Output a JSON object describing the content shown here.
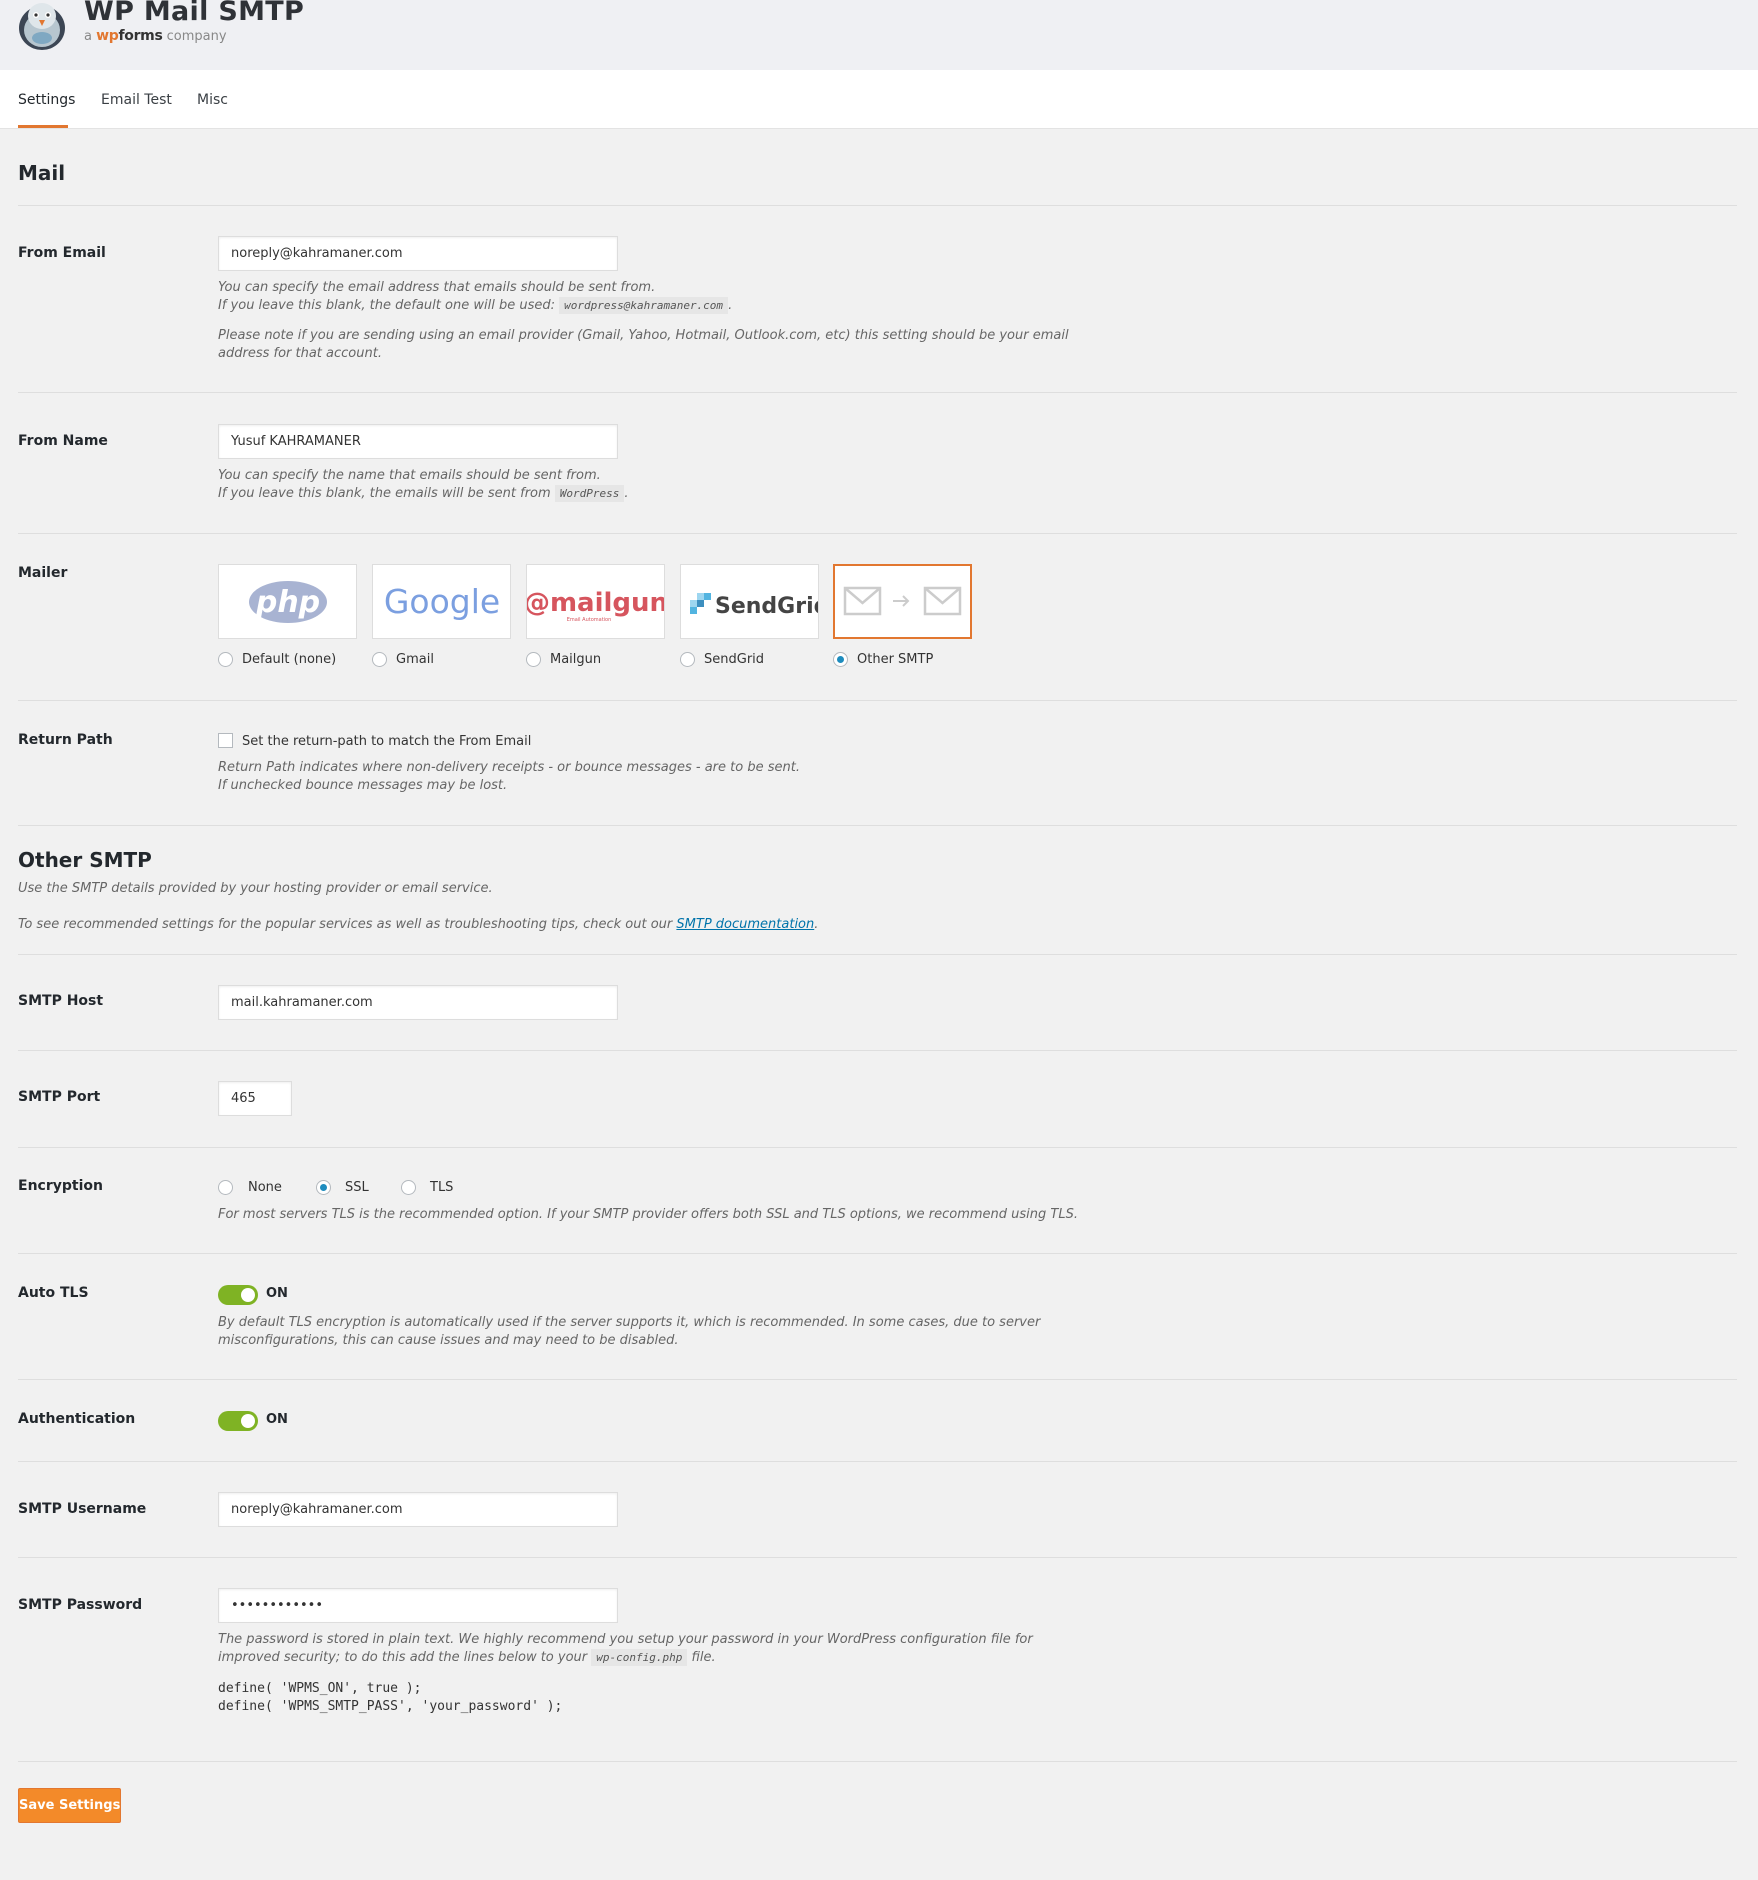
{
  "app": {
    "title": "WP Mail SMTP",
    "subtitle_prefix": "a",
    "subtitle_brand_wp": "wp",
    "subtitle_brand_forms": "forms",
    "subtitle_suffix": "company"
  },
  "tabs": [
    {
      "label": "Settings",
      "active": true
    },
    {
      "label": "Email Test",
      "active": false
    },
    {
      "label": "Misc",
      "active": false
    }
  ],
  "mail_section": {
    "heading": "Mail",
    "from_email": {
      "label": "From Email",
      "value": "noreply@kahramaner.com",
      "desc1": "You can specify the email address that emails should be sent from.",
      "desc2_prefix": "If you leave this blank, the default one will be used:",
      "desc2_code": "wordpress@kahramaner.com",
      "desc2_suffix": ".",
      "desc3": "Please note if you are sending using an email provider (Gmail, Yahoo, Hotmail, Outlook.com, etc) this setting should be your email",
      "desc4": "address for that account."
    },
    "from_name": {
      "label": "From Name",
      "value": "Yusuf KAHRAMANER",
      "desc1": "You can specify the name that emails should be sent from.",
      "desc2_prefix": "If you leave this blank, the emails will be sent from",
      "desc2_code": "WordPress",
      "desc2_suffix": "."
    },
    "mailer": {
      "label": "Mailer",
      "options": [
        {
          "name": "Default (none)",
          "logo_text": "php",
          "selected": false
        },
        {
          "name": "Gmail",
          "logo_text": "Google",
          "selected": false
        },
        {
          "name": "Mailgun",
          "logo_text": "@mailgun",
          "logo_subtext": "Email Automation",
          "selected": false
        },
        {
          "name": "SendGrid",
          "logo_text": "SendGrid",
          "selected": false
        },
        {
          "name": "Other SMTP",
          "logo_text": "",
          "selected": true
        }
      ]
    },
    "return_path": {
      "label": "Return Path",
      "checkbox_label": "Set the return-path to match the From Email",
      "checked": false,
      "desc1": "Return Path indicates where non-delivery receipts - or bounce messages - are to be sent.",
      "desc2": "If unchecked bounce messages may be lost."
    }
  },
  "smtp_section": {
    "heading": "Other SMTP",
    "desc1": "Use the SMTP details provided by your hosting provider or email service.",
    "desc2_prefix": "To see recommended settings for the popular services as well as troubleshooting tips, check out our",
    "desc2_link": "SMTP documentation",
    "desc2_suffix": ".",
    "host": {
      "label": "SMTP Host",
      "value": "mail.kahramaner.com"
    },
    "port": {
      "label": "SMTP Port",
      "value": "465"
    },
    "encryption": {
      "label": "Encryption",
      "options": [
        {
          "name": "None",
          "selected": false
        },
        {
          "name": "SSL",
          "selected": true
        },
        {
          "name": "TLS",
          "selected": false
        }
      ],
      "desc": "For most servers TLS is the recommended option. If your SMTP provider offers both SSL and TLS options, we recommend using TLS."
    },
    "auto_tls": {
      "label": "Auto TLS",
      "state": "ON",
      "desc1": "By default TLS encryption is automatically used if the server supports it, which is recommended. In some cases, due to server",
      "desc2": "misconfigurations, this can cause issues and may need to be disabled."
    },
    "authentication": {
      "label": "Authentication",
      "state": "ON"
    },
    "username": {
      "label": "SMTP Username",
      "value": "noreply@kahramaner.com"
    },
    "password": {
      "label": "SMTP Password",
      "value": "••••••••••••",
      "desc1": "The password is stored in plain text. We highly recommend you setup your password in your WordPress configuration file for",
      "desc2_prefix": "improved security; to do this add the lines below to your",
      "desc2_code": "wp-config.php",
      "desc2_suffix": "file.",
      "code_line1": "define( 'WPMS_ON', true );",
      "code_line2": "define( 'WPMS_SMTP_PASS', 'your_password' );"
    }
  },
  "save_button": "Save Settings",
  "colors": {
    "accent": "#e27730",
    "toggle_on": "#7fb324",
    "link": "#0073aa"
  }
}
